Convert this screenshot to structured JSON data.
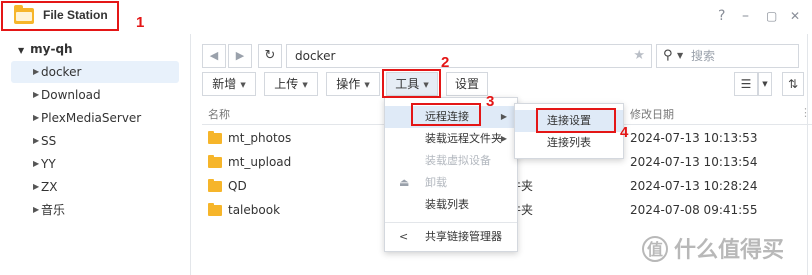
{
  "window": {
    "title": "File Station",
    "help": "?",
    "minimize": "–",
    "maximize": "▢",
    "close": "✕"
  },
  "sidebar": {
    "root": "my-qh",
    "items": [
      {
        "label": "docker",
        "selected": true
      },
      {
        "label": "Download"
      },
      {
        "label": "PlexMediaServer"
      },
      {
        "label": "SS"
      },
      {
        "label": "YY"
      },
      {
        "label": "ZX"
      },
      {
        "label": "音乐"
      }
    ]
  },
  "toolbar": {
    "path": "docker",
    "search_placeholder": "搜索",
    "buttons": {
      "new": "新增",
      "upload": "上传",
      "action": "操作",
      "tools": "工具",
      "settings": "设置"
    }
  },
  "table": {
    "columns": {
      "name": "名称",
      "modified": "修改日期"
    },
    "rows": [
      {
        "name": "mt_photos",
        "type": "",
        "modified": "2024-07-13 10:13:53"
      },
      {
        "name": "mt_upload",
        "type": "",
        "modified": "2024-07-13 10:13:54"
      },
      {
        "name": "QD",
        "type": "件夹",
        "modified": "2024-07-13 10:28:24"
      },
      {
        "name": "talebook",
        "type": "件夹",
        "modified": "2024-07-08 09:41:55"
      }
    ]
  },
  "tools_menu": {
    "items": {
      "remote": "远程连接",
      "mount_remote": "装载远程文件夹",
      "mount_virtual": "装载虚拟设备",
      "unmount": "卸载",
      "mount_list": "装载列表",
      "share_link": "共享链接管理器"
    }
  },
  "remote_submenu": {
    "items": {
      "settings": "连接设置",
      "list": "连接列表"
    }
  },
  "annotations": {
    "n1": "1",
    "n2": "2",
    "n3": "3",
    "n4": "4"
  },
  "watermark": {
    "icon": "值",
    "text": "什么值得买"
  },
  "colors": {
    "accent_red": "#e41616",
    "folder": "#f6b52a",
    "selected": "#e8f1fb",
    "highlight": "#dfeaf7"
  }
}
